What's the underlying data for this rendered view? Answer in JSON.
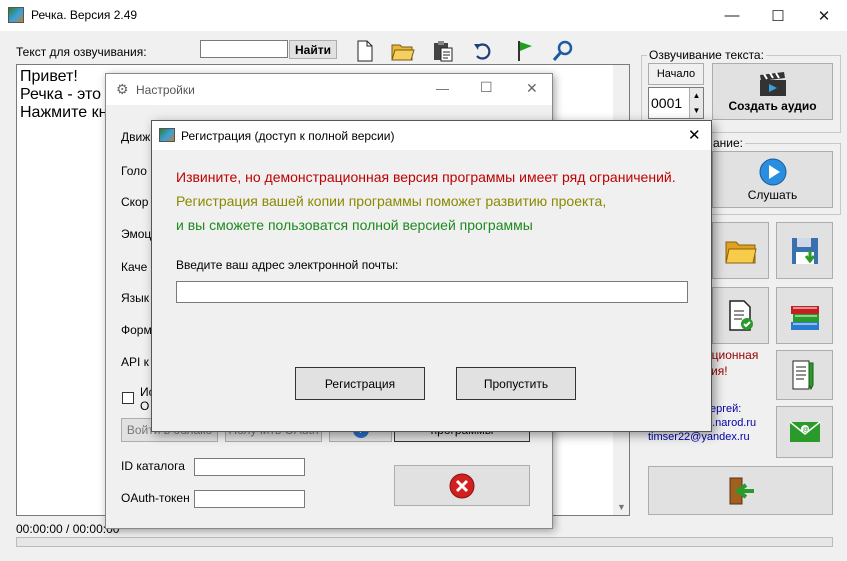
{
  "main_window": {
    "title": "Речка. Версия 2.49",
    "text_label": "Текст для озвучивания:",
    "search_value": "",
    "find_button": "Найти",
    "editor_lines": [
      "Привет!",
      "Речка - это с",
      "Нажмите кно"
    ],
    "voicing_group": "Озвучивание текста:",
    "start_label": "Начало",
    "start_value": "0001",
    "create_audio_button": "Создать аудио",
    "listen_group": "ание:",
    "listen_button": "Слушать",
    "info_text_1": "ационная",
    "info_text_2": "сия!",
    "author_1": "ергей:",
    "author_2": "2.narod.ru",
    "author_email": "timser22@yandex.ru",
    "time_display": "00:00:00 / 00:00:00"
  },
  "settings_window": {
    "title": "Настройки",
    "labels": [
      "Движ",
      "Голо",
      "Скор",
      "Эмоц",
      "Каче",
      "Язык",
      "Форм",
      "API к",
      "Ис",
      "О"
    ],
    "partial_buttons": [
      "Войти в облако",
      "Получить OAuth",
      "программы"
    ],
    "catalog_id_label": "ID каталога",
    "catalog_id_value": "",
    "oauth_label": "OAuth-токен",
    "oauth_value": ""
  },
  "registration_dialog": {
    "title": "Регистрация (доступ к полной версии)",
    "message_red": "Извините, но демонстрационная версия программы имеет ряд ограничений.",
    "message_olive": "Регистрация вашей копии программы поможет развитию проекта,",
    "message_green": "и вы сможете пользоватся полной версией программы",
    "email_label": "Введите ваш адрес электронной почты:",
    "email_value": "",
    "register_button": "Регистрация",
    "skip_button": "Пропустить"
  },
  "colors": {
    "red": "#c00000",
    "olive": "#8a8a00",
    "green": "#1e8a1e",
    "dark_red": "#990000",
    "link_blue": "#0000aa"
  }
}
